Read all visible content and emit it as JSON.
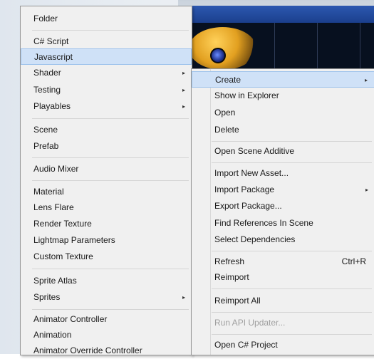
{
  "left_menu": {
    "items": [
      {
        "label": "Folder"
      },
      {
        "label": "C# Script"
      },
      {
        "label": "Javascript",
        "highlighted": true
      },
      {
        "label": "Shader",
        "submenu": true
      },
      {
        "label": "Testing",
        "submenu": true
      },
      {
        "label": "Playables",
        "submenu": true
      },
      {
        "label": "Scene"
      },
      {
        "label": "Prefab"
      },
      {
        "label": "Audio Mixer"
      },
      {
        "label": "Material"
      },
      {
        "label": "Lens Flare"
      },
      {
        "label": "Render Texture"
      },
      {
        "label": "Lightmap Parameters"
      },
      {
        "label": "Custom Texture"
      },
      {
        "label": "Sprite Atlas"
      },
      {
        "label": "Sprites",
        "submenu": true
      },
      {
        "label": "Animator Controller"
      },
      {
        "label": "Animation"
      },
      {
        "label": "Animator Override Controller"
      }
    ]
  },
  "right_menu": {
    "items": [
      {
        "label": "Create",
        "submenu": true,
        "highlighted": true
      },
      {
        "label": "Show in Explorer"
      },
      {
        "label": "Open"
      },
      {
        "label": "Delete"
      },
      {
        "label": "Open Scene Additive"
      },
      {
        "label": "Import New Asset..."
      },
      {
        "label": "Import Package",
        "submenu": true
      },
      {
        "label": "Export Package..."
      },
      {
        "label": "Find References In Scene"
      },
      {
        "label": "Select Dependencies"
      },
      {
        "label": "Refresh",
        "shortcut": "Ctrl+R"
      },
      {
        "label": "Reimport"
      },
      {
        "label": "Reimport All"
      },
      {
        "label": "Run API Updater...",
        "disabled": true
      },
      {
        "label": "Open C# Project"
      }
    ]
  },
  "submenu_arrow": "▸",
  "colors": {
    "menu_background": "#f0f0f0",
    "highlight": "#cfe1f7",
    "highlight_border": "#9ec3ec",
    "disabled_text": "#a0a0a0"
  }
}
